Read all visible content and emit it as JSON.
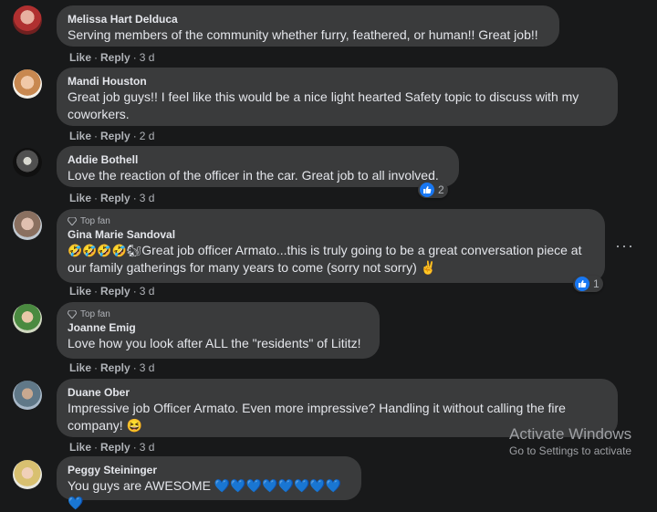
{
  "comments": [
    {
      "author": "Melissa Hart Delduca",
      "text": "Serving members of the community whether furry, feathered, or human!! Great job!!",
      "like": "Like",
      "reply": "Reply",
      "time": "3 d"
    },
    {
      "author": "Mandi Houston",
      "text": "Great job guys!! I feel like this would be a nice light hearted Safety topic to discuss with my coworkers.",
      "like": "Like",
      "reply": "Reply",
      "time": "2 d"
    },
    {
      "author": "Addie Bothell",
      "text": "Love the reaction of the officer in the car. Great job to all involved.",
      "like": "Like",
      "reply": "Reply",
      "time": "3 d",
      "reaction_count": "2"
    },
    {
      "badge": "Top fan",
      "author": "Gina Marie Sandoval",
      "emoji_prefix": "🤣🤣🤣🤣🐿",
      "text": "Great job officer Armato...this is truly going to be a great conversation piece at our family gatherings for many years to come (sorry not sorry) ✌",
      "like": "Like",
      "reply": "Reply",
      "time": "3 d",
      "reaction_count": "1"
    },
    {
      "badge": "Top fan",
      "author": "Joanne Emig",
      "text": "Love how you look after ALL the \"residents\" of Lititz!",
      "like": "Like",
      "reply": "Reply",
      "time": "3 d"
    },
    {
      "author": "Duane Ober",
      "text": "Impressive job Officer Armato. Even more impressive? Handling it without calling the fire company! 😆",
      "like": "Like",
      "reply": "Reply",
      "time": "3 d"
    },
    {
      "author": "Peggy Steininger",
      "text": "You guys are AWESOME 💙💙💙💙💙💙💙💙💙"
    }
  ],
  "more_options": "···",
  "watermark": {
    "title": "Activate Windows",
    "subtitle": "Go to Settings to activate"
  }
}
